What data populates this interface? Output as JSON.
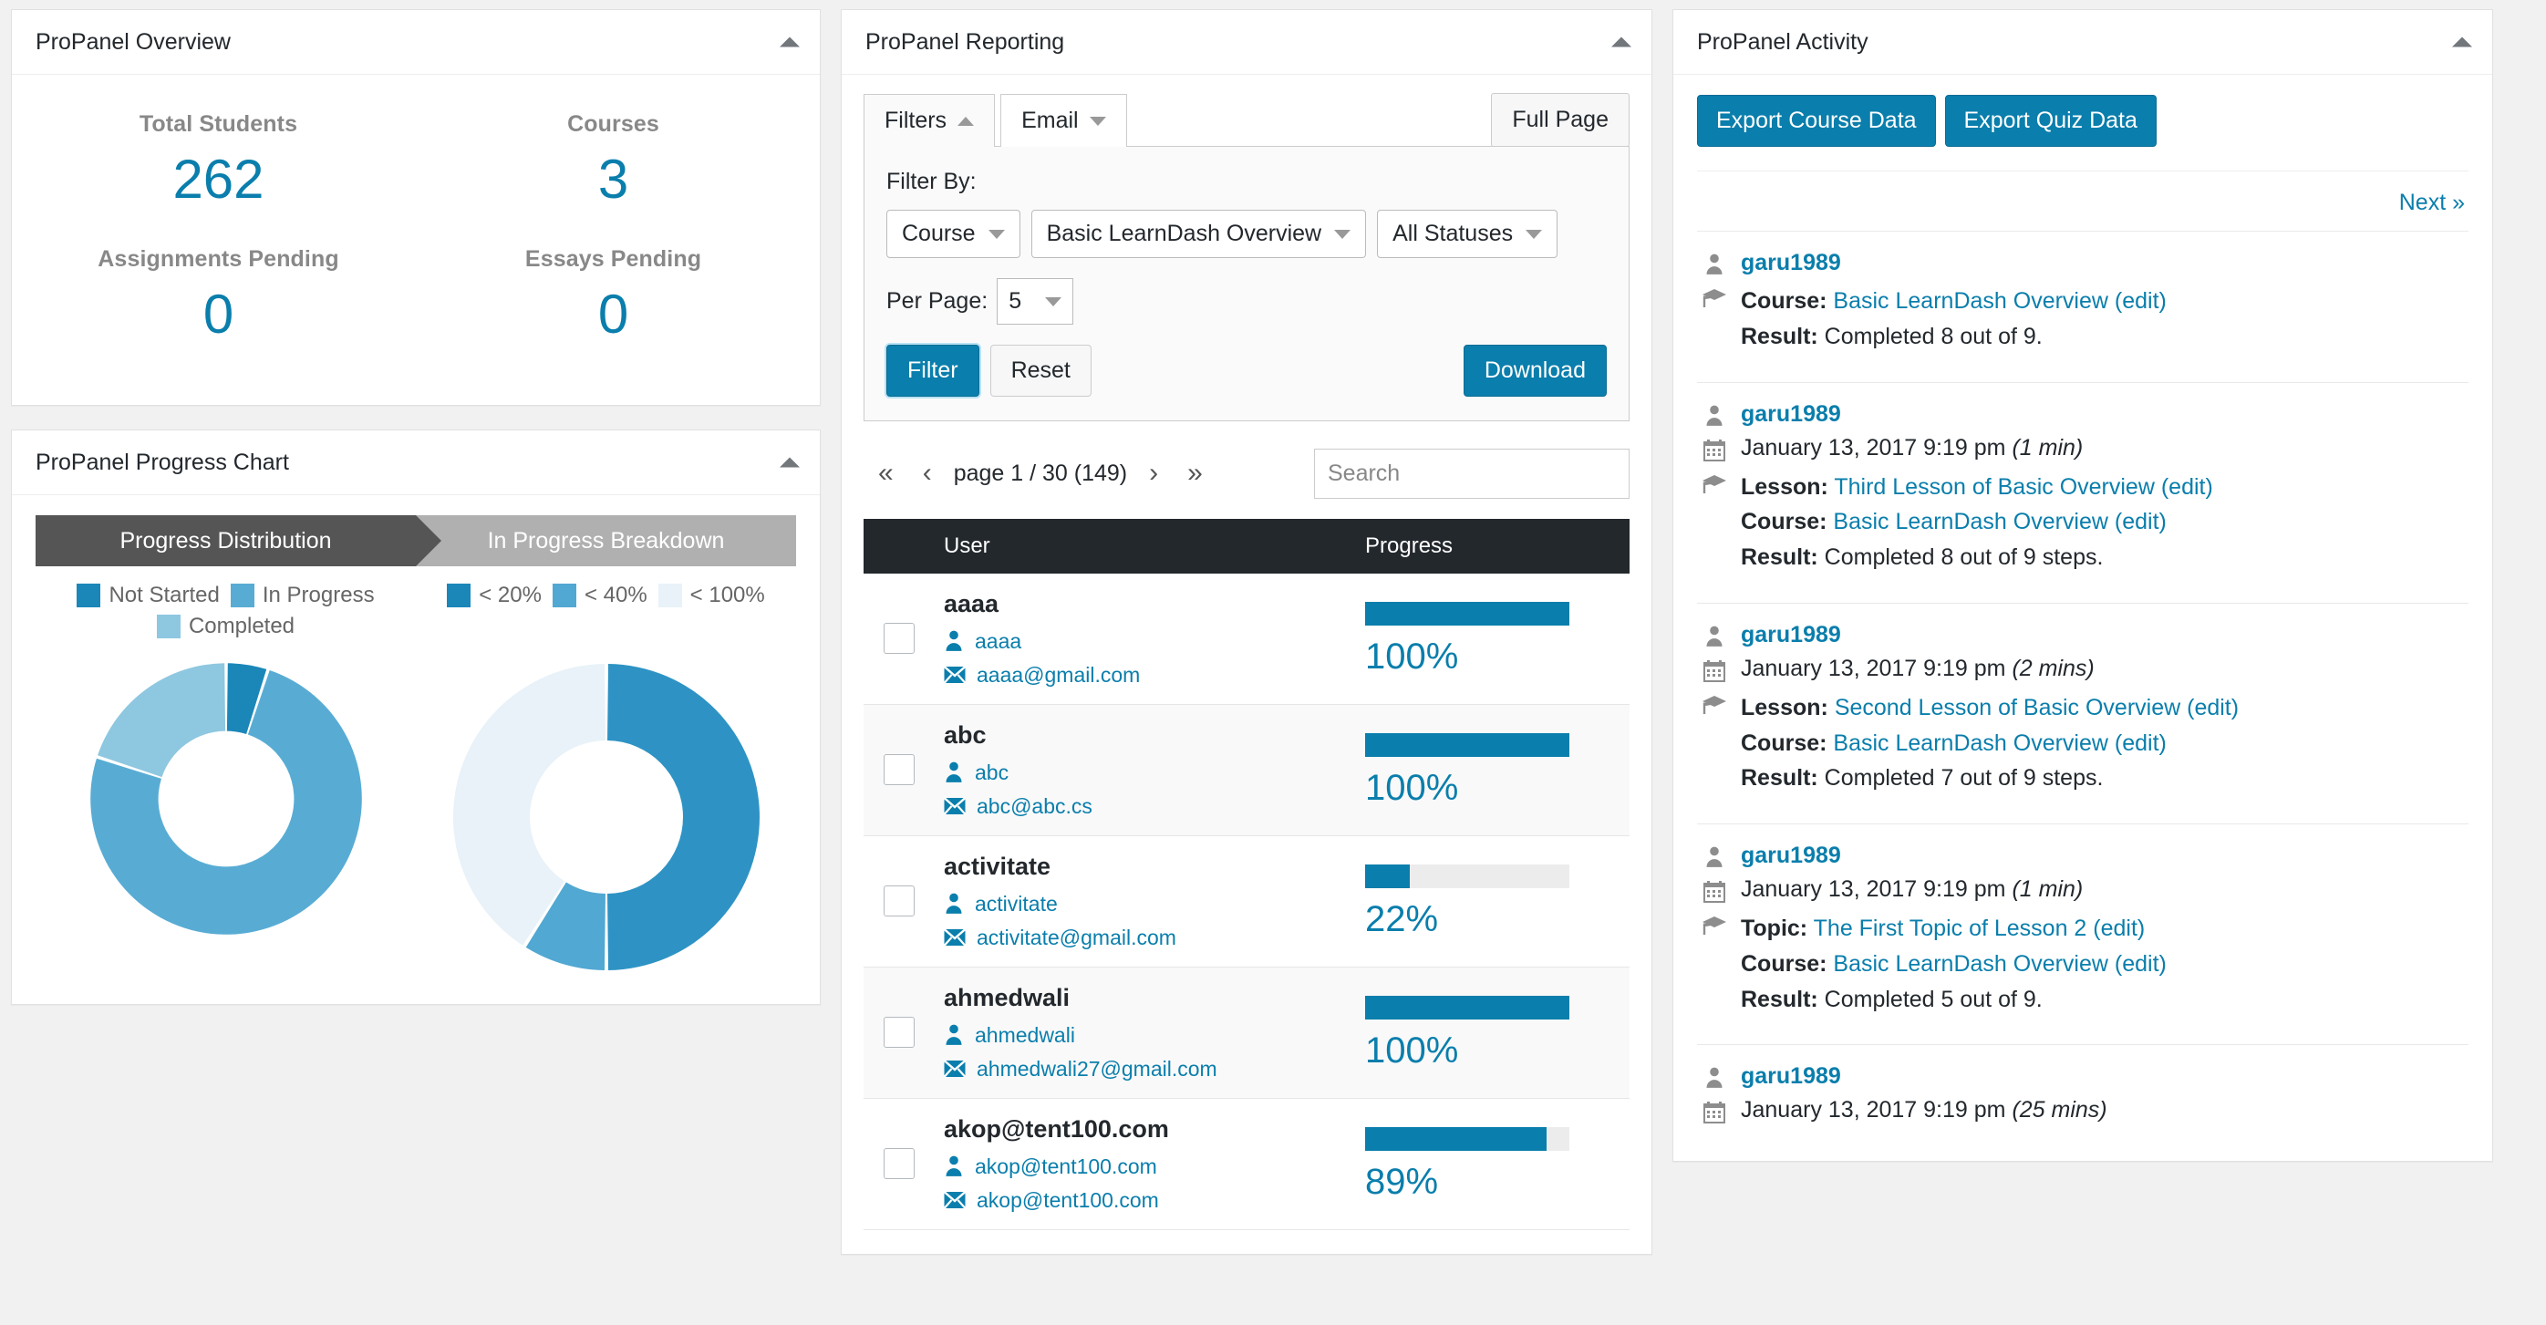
{
  "overview": {
    "title": "ProPanel Overview",
    "stats": [
      {
        "label": "Total Students",
        "value": "262"
      },
      {
        "label": "Courses",
        "value": "3"
      },
      {
        "label": "Assignments Pending",
        "value": "0"
      },
      {
        "label": "Essays Pending",
        "value": "0"
      }
    ]
  },
  "progress_chart": {
    "title": "ProPanel Progress Chart",
    "tabs": [
      {
        "label": "Progress Distribution",
        "active": true
      },
      {
        "label": "In Progress Breakdown",
        "active": false
      }
    ],
    "legend_left": [
      {
        "label": "Not Started",
        "color": "#1b87b9"
      },
      {
        "label": "In Progress",
        "color": "#58acd4"
      },
      {
        "label": "Completed",
        "color": "#8ec7e0"
      }
    ],
    "legend_right": [
      {
        "label": "< 20%",
        "color": "#1b87b9"
      },
      {
        "label": "< 40%",
        "color": "#51a8d2"
      },
      {
        "label": "< 100%",
        "color": "#e8f2f8"
      }
    ]
  },
  "chart_data": [
    {
      "type": "pie",
      "title": "Progress Distribution",
      "labels": [
        "Not Started",
        "In Progress",
        "Completed"
      ],
      "values": [
        5,
        75,
        20
      ],
      "colors": [
        "#1b87b9",
        "#58acd4",
        "#8ec7e0"
      ],
      "legend_position": "top",
      "donut": true
    },
    {
      "type": "pie",
      "title": "In Progress Breakdown",
      "labels": [
        "< 20%",
        "< 40%",
        "< 100%"
      ],
      "values": [
        50,
        9,
        41
      ],
      "colors": [
        "#2e93c4",
        "#51a8d2",
        "#e8f2f8"
      ],
      "legend_position": "top",
      "donut": true
    }
  ],
  "reporting": {
    "title": "ProPanel Reporting",
    "tabs": [
      {
        "label": "Filters",
        "caret": "caret-up-icon",
        "open": true
      },
      {
        "label": "Email",
        "caret": "caret-down-icon",
        "open": false
      }
    ],
    "full_page_label": "Full Page",
    "filter_by_label": "Filter By:",
    "selects": [
      {
        "name": "type-select",
        "value": "Course"
      },
      {
        "name": "course-select",
        "value": "Basic LearnDash Overview"
      },
      {
        "name": "status-select",
        "value": "All Statuses"
      }
    ],
    "per_page_label": "Per Page:",
    "per_page_value": "5",
    "filter_button": "Filter",
    "reset_button": "Reset",
    "download_button": "Download",
    "pagination": {
      "first": "«",
      "prev": "‹",
      "label": "page 1 / 30 (149)",
      "next": "›",
      "last": "»"
    },
    "search_placeholder": "Search",
    "search_value": "",
    "columns": [
      "",
      "User",
      "Progress"
    ],
    "rows": [
      {
        "name": "aaaa",
        "username": "aaaa",
        "email": "aaaa@gmail.com",
        "progress": 100,
        "progress_label": "100%"
      },
      {
        "name": "abc",
        "username": "abc",
        "email": "abc@abc.cs",
        "progress": 100,
        "progress_label": "100%"
      },
      {
        "name": "activitate",
        "username": "activitate",
        "email": "activitate@gmail.com",
        "progress": 22,
        "progress_label": "22%"
      },
      {
        "name": "ahmedwali",
        "username": "ahmedwali",
        "email": "ahmedwali27@gmail.com",
        "progress": 100,
        "progress_label": "100%"
      },
      {
        "name": "akop@tent100.com",
        "username": "akop@tent100.com",
        "email": "akop@tent100.com",
        "progress": 89,
        "progress_label": "89%"
      }
    ]
  },
  "activity": {
    "title": "ProPanel Activity",
    "export_course_button": "Export Course Data",
    "export_quiz_button": "Export Quiz Data",
    "next_label": "Next »",
    "items": [
      {
        "user": "garu1989",
        "date": "",
        "duration": "",
        "primary_label": "Course:",
        "primary_link": "Basic LearnDash Overview",
        "primary_edit": "(edit)",
        "course_label": "",
        "course_link": "",
        "course_edit": "",
        "result": "Result: Completed 8 out of 9."
      },
      {
        "user": "garu1989",
        "date": "January 13, 2017 9:19 pm",
        "duration": "(1 min)",
        "primary_label": "Lesson:",
        "primary_link": "Third Lesson of Basic Overview",
        "primary_edit": "(edit)",
        "course_label": "Course:",
        "course_link": "Basic LearnDash Overview",
        "course_edit": "(edit)",
        "result": "Result: Completed 8 out of 9 steps."
      },
      {
        "user": "garu1989",
        "date": "January 13, 2017 9:19 pm",
        "duration": "(2 mins)",
        "primary_label": "Lesson:",
        "primary_link": "Second Lesson of Basic Overview",
        "primary_edit": "(edit)",
        "course_label": "Course:",
        "course_link": "Basic LearnDash Overview",
        "course_edit": "(edit)",
        "result": "Result: Completed 7 out of 9 steps."
      },
      {
        "user": "garu1989",
        "date": "January 13, 2017 9:19 pm",
        "duration": "(1 min)",
        "primary_label": "Topic:",
        "primary_link": "The First Topic of Lesson 2",
        "primary_edit": "(edit)",
        "course_label": "Course:",
        "course_link": "Basic LearnDash Overview",
        "course_edit": "(edit)",
        "result": "Result: Completed 5 out of 9."
      },
      {
        "user": "garu1989",
        "date": "January 13, 2017 9:19 pm",
        "duration": "(25 mins)",
        "primary_label": "",
        "primary_link": "",
        "primary_edit": "",
        "course_label": "",
        "course_link": "",
        "course_edit": "",
        "result": ""
      }
    ]
  },
  "colors": {
    "accent": "#0a7eac",
    "header_bar": "#23282d",
    "tab_active": "#555555",
    "tab_inactive": "#b0b0b0"
  }
}
